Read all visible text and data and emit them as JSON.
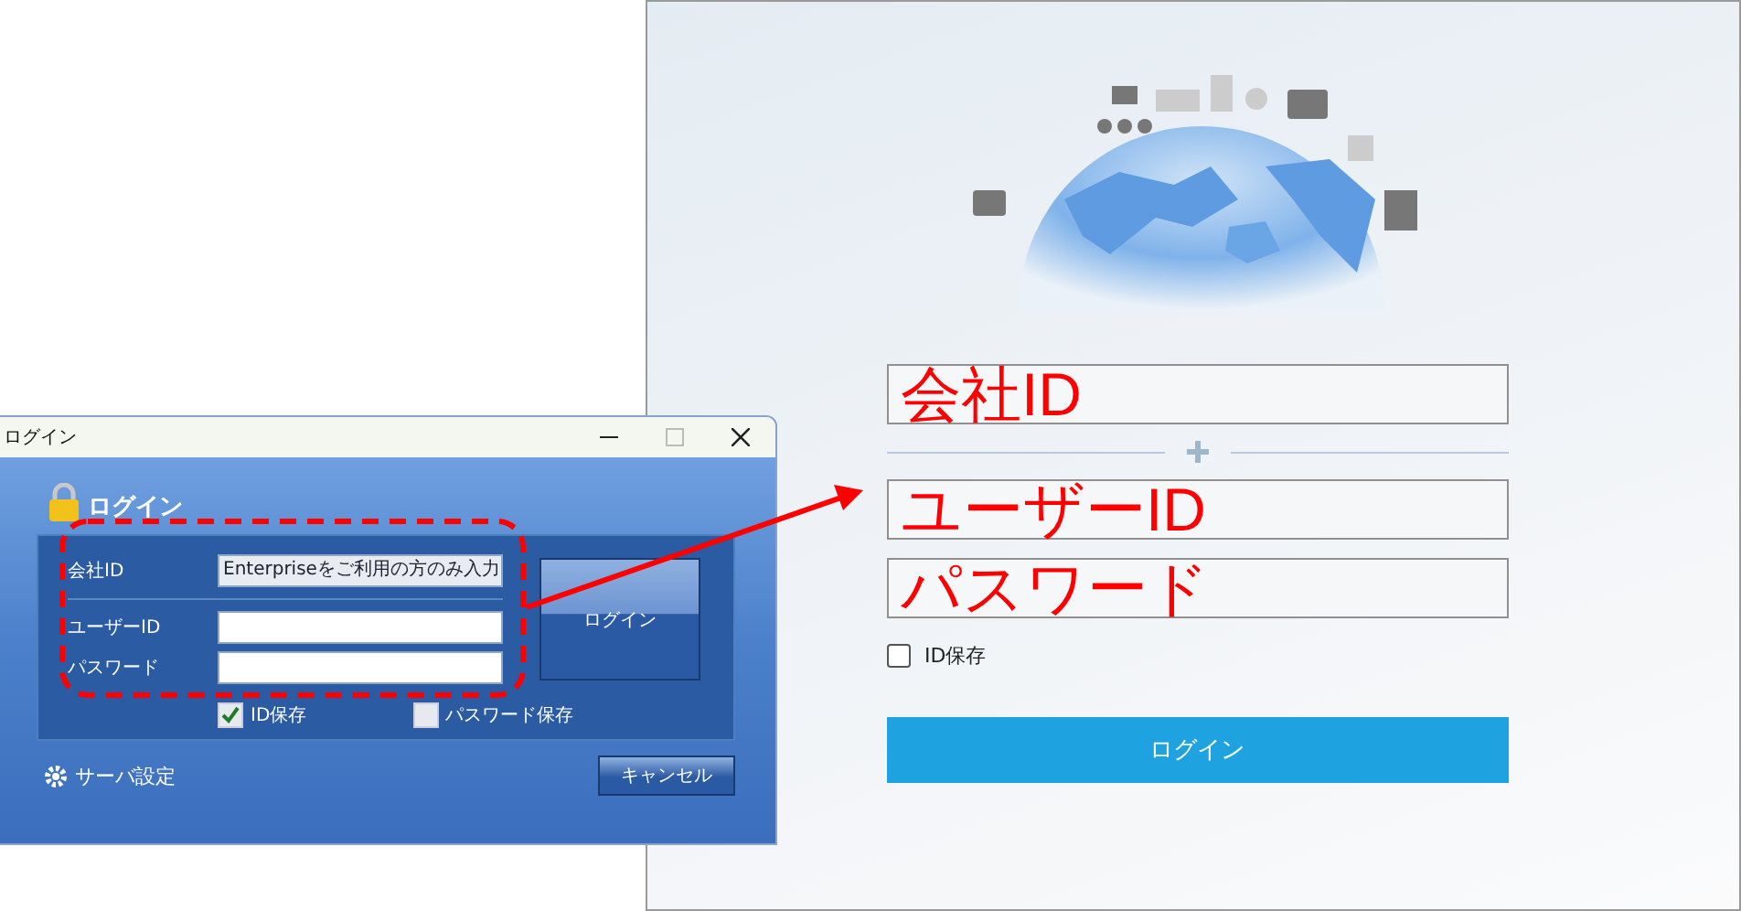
{
  "old_dialog": {
    "title": "ログイン",
    "header": "ログイン",
    "fields": [
      {
        "label": "会社ID",
        "value": "Enterpriseをご利用の方のみ入力"
      },
      {
        "label": "ユーザーID"
      },
      {
        "label": "パスワード"
      }
    ],
    "login_button": "ログイン",
    "checkboxes": [
      {
        "label": "ID保存",
        "checked": true
      },
      {
        "label": "パスワード保存",
        "checked": false
      }
    ],
    "server_settings": "サーバ設定",
    "cancel_button": "キャンセル"
  },
  "new_login": {
    "company_field": {
      "annotation": "会社ID"
    },
    "account_fields": [
      {
        "annotation": "ユーザーID"
      },
      {
        "annotation": "パスワード"
      }
    ],
    "checkbox": {
      "label": "ID保存",
      "checked": false
    },
    "login_button": "ログイン"
  }
}
